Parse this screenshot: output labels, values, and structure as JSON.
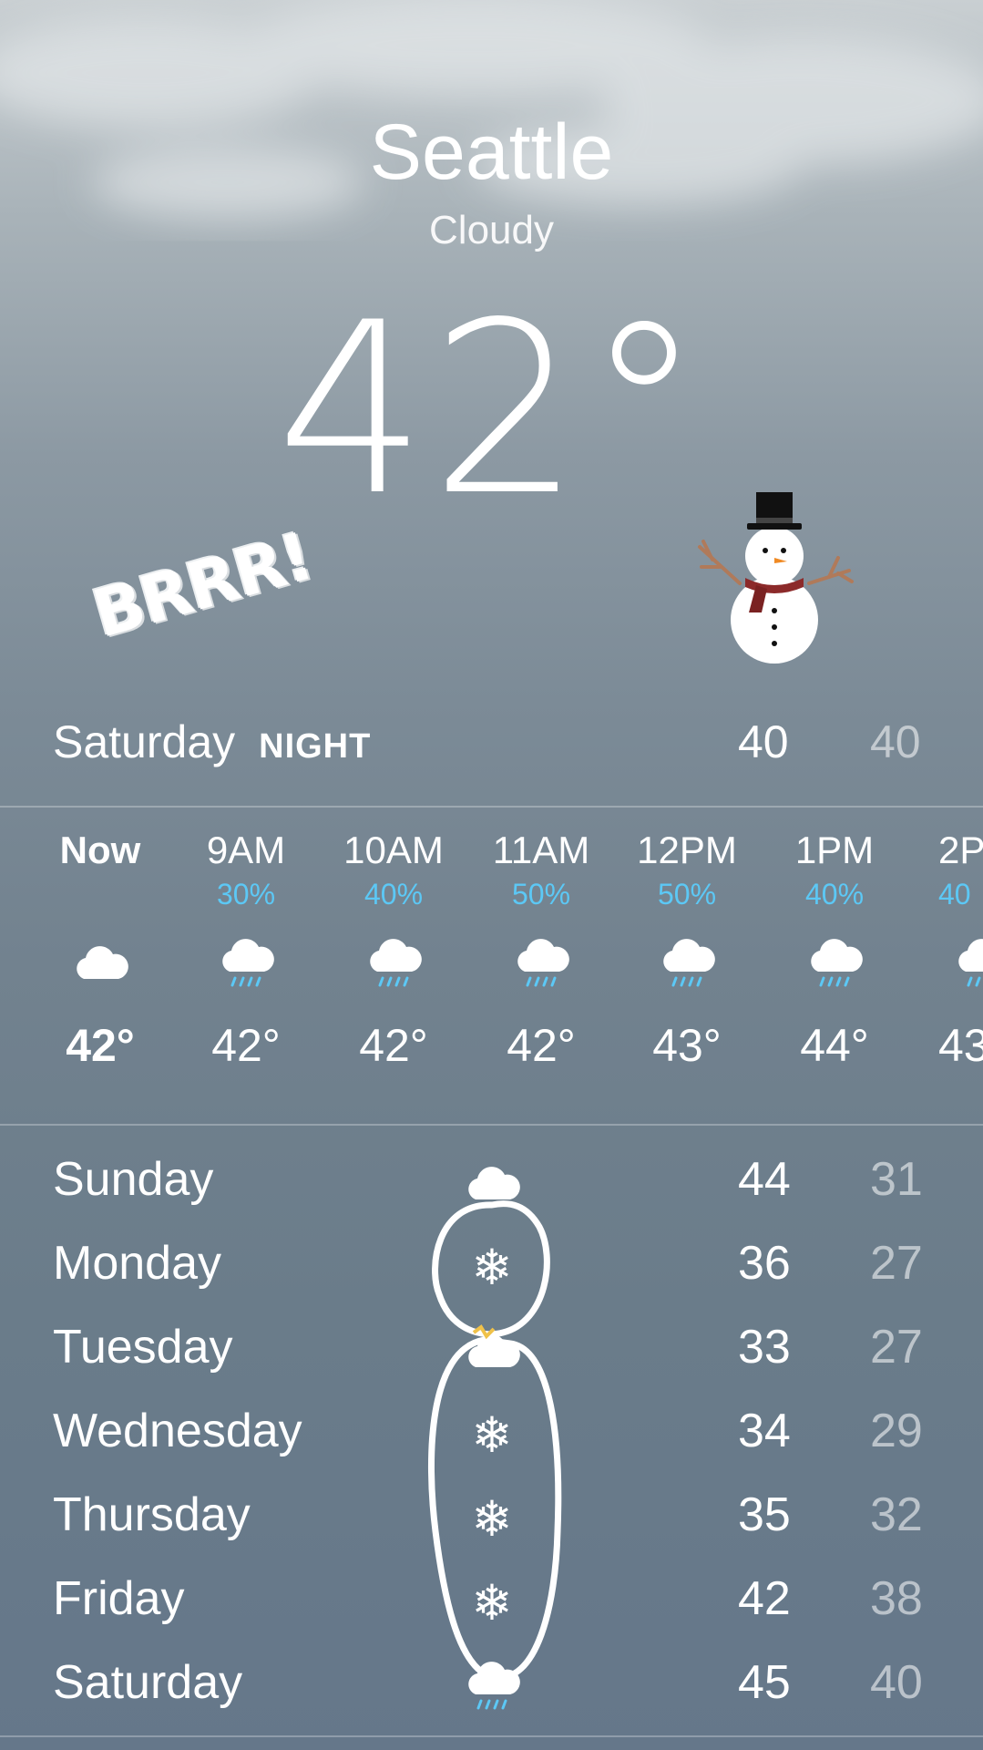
{
  "header": {
    "city": "Seattle",
    "condition": "Cloudy",
    "temperature": "42°"
  },
  "stickers": {
    "brrr_text": "BRRR!",
    "snowman": "snowman-sticker"
  },
  "today": {
    "day": "Saturday",
    "period": "NIGHT",
    "high": "40",
    "low": "40"
  },
  "hourly": [
    {
      "time": "Now",
      "pct": "",
      "icon": "cloud-icon",
      "temp": "42°"
    },
    {
      "time": "9AM",
      "pct": "30%",
      "icon": "cloud-rain-icon",
      "temp": "42°"
    },
    {
      "time": "10AM",
      "pct": "40%",
      "icon": "cloud-rain-icon",
      "temp": "42°"
    },
    {
      "time": "11AM",
      "pct": "50%",
      "icon": "cloud-rain-icon",
      "temp": "42°"
    },
    {
      "time": "12PM",
      "pct": "50%",
      "icon": "cloud-rain-icon",
      "temp": "43°"
    },
    {
      "time": "1PM",
      "pct": "40%",
      "icon": "cloud-rain-icon",
      "temp": "44°"
    },
    {
      "time": "2P",
      "pct": "40",
      "icon": "cloud-rain-icon",
      "temp": "43"
    }
  ],
  "daily": [
    {
      "day": "Sunday",
      "icon": "cloud-icon",
      "hi": "44",
      "lo": "31"
    },
    {
      "day": "Monday",
      "icon": "snowflake-icon",
      "hi": "36",
      "lo": "27"
    },
    {
      "day": "Tuesday",
      "icon": "cloud-icon",
      "hi": "33",
      "lo": "27"
    },
    {
      "day": "Wednesday",
      "icon": "snowflake-icon",
      "hi": "34",
      "lo": "29"
    },
    {
      "day": "Thursday",
      "icon": "snowflake-icon",
      "hi": "35",
      "lo": "32"
    },
    {
      "day": "Friday",
      "icon": "snowflake-icon",
      "hi": "42",
      "lo": "38"
    },
    {
      "day": "Saturday",
      "icon": "cloud-rain-icon",
      "hi": "45",
      "lo": "40"
    }
  ],
  "colors": {
    "precip_blue": "#5cc8f5",
    "bg_top": "#c9cfd2",
    "bg_bottom": "#65778a"
  }
}
